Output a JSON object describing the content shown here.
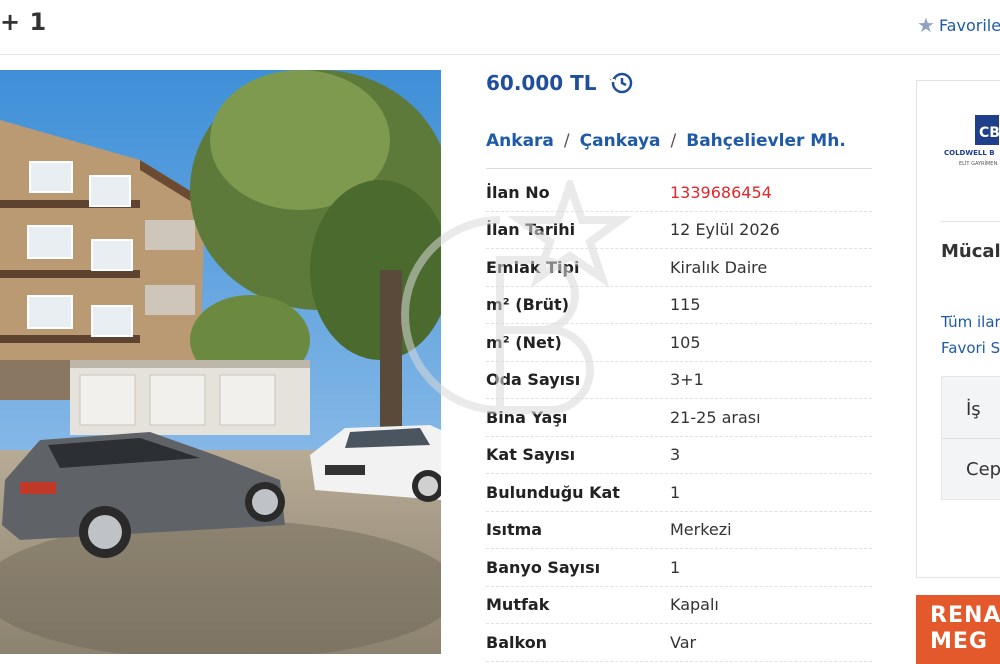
{
  "header": {
    "title_fragment": "+ 1",
    "favorite_label": "Favorile"
  },
  "listing": {
    "price": "60.000 TL",
    "breadcrumb": [
      "Ankara",
      "Çankaya",
      "Bahçelievler Mh."
    ],
    "breadcrumb_separator": "/",
    "details": [
      {
        "key": "İlan No",
        "value": "1339686454",
        "highlight": true
      },
      {
        "key": "İlan Tarihi",
        "value": "12 Eylül 2026"
      },
      {
        "key": "Emlak Tipi",
        "value": "Kiralık Daire"
      },
      {
        "key": "m² (Brüt)",
        "value": "115"
      },
      {
        "key": "m² (Net)",
        "value": "105"
      },
      {
        "key": "Oda Sayısı",
        "value": "3+1"
      },
      {
        "key": "Bina Yaşı",
        "value": "21-25 arası"
      },
      {
        "key": "Kat Sayısı",
        "value": "3"
      },
      {
        "key": "Bulunduğu Kat",
        "value": "1"
      },
      {
        "key": "Isıtma",
        "value": "Merkezi"
      },
      {
        "key": "Banyo Sayısı",
        "value": "1"
      },
      {
        "key": "Mutfak",
        "value": "Kapalı"
      },
      {
        "key": "Balkon",
        "value": "Var"
      }
    ]
  },
  "agent": {
    "logo_text": "COLDWELL B",
    "logo_subtext": "ELİT GAYRİMEN",
    "name": "Mücal",
    "link_all": "Tüm ilar",
    "link_fav": "Favori S",
    "phone_work": "İş",
    "phone_cell": "Cep"
  },
  "promo": {
    "line1": "RENA",
    "line2": "MEG"
  },
  "colors": {
    "accent": "#1f5aa8",
    "listing_no": "#e12727",
    "promo": "#e4592b"
  }
}
